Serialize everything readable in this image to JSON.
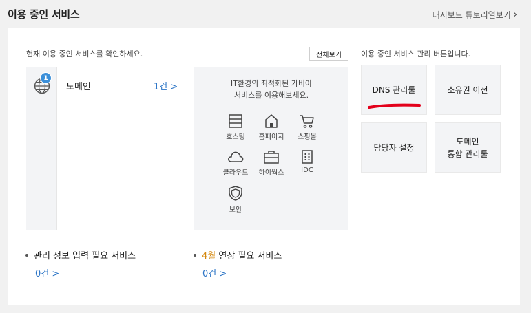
{
  "header": {
    "title": "이용 중인 서비스",
    "tutorial_link": "대시보드 튜토리얼보기"
  },
  "current_services": {
    "intro": "현재 이용 중인 서비스를 확인하세요.",
    "view_all": "전체보기",
    "items": [
      {
        "label": "도메인",
        "count": "1건 >",
        "badge": "1",
        "icon": "globe-icon"
      }
    ]
  },
  "promo": {
    "line1": "IT환경의 최적화된 가비아",
    "line2": "서비스를 이용해보세요.",
    "services": [
      {
        "label": "호스팅",
        "icon": "hosting-icon"
      },
      {
        "label": "홈페이지",
        "icon": "home-icon"
      },
      {
        "label": "쇼핑몰",
        "icon": "cart-icon"
      },
      {
        "label": "클라우드",
        "icon": "cloud-icon"
      },
      {
        "label": "하이웍스",
        "icon": "briefcase-icon"
      },
      {
        "label": "IDC",
        "icon": "building-icon"
      },
      {
        "label": "보안",
        "icon": "shield-icon"
      }
    ]
  },
  "management": {
    "intro": "이용 중인 서비스 관리 버튼입니다.",
    "buttons": [
      {
        "label": "DNS 관리툴"
      },
      {
        "label": "소유권 이전"
      },
      {
        "label": "담당자 설정"
      },
      {
        "label_line1": "도메인",
        "label_line2": "통합 관리툴"
      }
    ],
    "highlight_color": "#e3001b"
  },
  "notices": [
    {
      "text": "관리 정보 입력 필요 서비스",
      "count": "0건 >"
    },
    {
      "month": "4월",
      "text": " 연장 필요 서비스",
      "count": "0건 >"
    }
  ],
  "colors": {
    "link": "#2a74c6",
    "badge": "#3b8fd9",
    "month": "#d4870c"
  }
}
